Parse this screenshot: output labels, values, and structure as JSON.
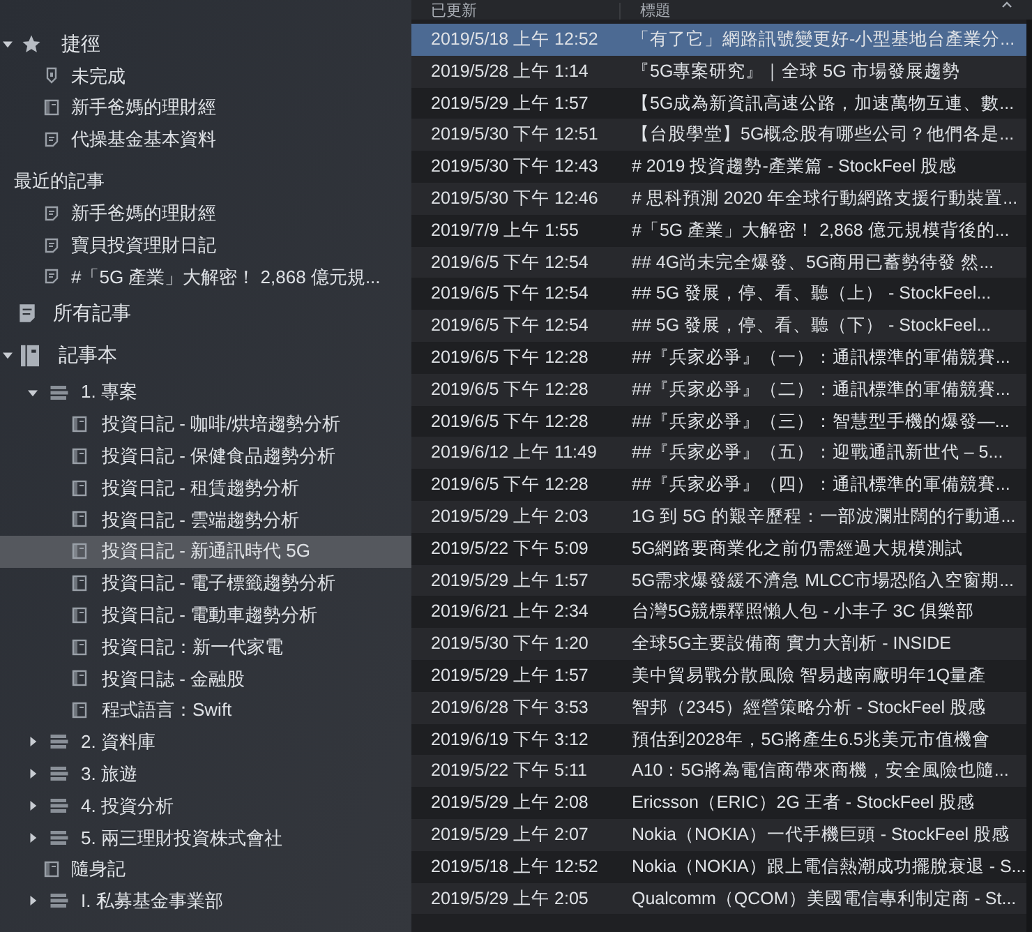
{
  "sidebar": {
    "shortcuts": {
      "label": "捷徑",
      "expanded": true,
      "items": [
        {
          "label": "未完成",
          "kind": "tag"
        },
        {
          "label": "新手爸媽的理財經",
          "kind": "notebook"
        },
        {
          "label": "代操基金基本資料",
          "kind": "note"
        }
      ]
    },
    "recent": {
      "label": "最近的記事",
      "items": [
        {
          "label": "新手爸媽的理財經",
          "kind": "note"
        },
        {
          "label": "寶貝投資理財日記",
          "kind": "note"
        },
        {
          "label": "#「5G 產業」大解密！ 2,868 億元規...",
          "kind": "note"
        }
      ]
    },
    "all_notes": {
      "label": "所有記事"
    },
    "notebooks": {
      "label": "記事本",
      "expanded": true,
      "children": [
        {
          "label": "1. 專案",
          "kind": "stack",
          "expanded": true,
          "children": [
            {
              "label": "投資日記 - 咖啡/烘培趨勢分析",
              "kind": "notebook",
              "selected": false
            },
            {
              "label": "投資日記 - 保健食品趨勢分析",
              "kind": "notebook",
              "selected": false
            },
            {
              "label": "投資日記 - 租賃趨勢分析",
              "kind": "notebook",
              "selected": false
            },
            {
              "label": "投資日記 - 雲端趨勢分析",
              "kind": "notebook",
              "selected": false
            },
            {
              "label": "投資日記 - 新通訊時代 5G",
              "kind": "notebook",
              "selected": true
            },
            {
              "label": "投資日記 - 電子標籤趨勢分析",
              "kind": "notebook",
              "selected": false
            },
            {
              "label": "投資日記 - 電動車趨勢分析",
              "kind": "notebook",
              "selected": false
            },
            {
              "label": "投資日記：新一代家電",
              "kind": "notebook",
              "selected": false
            },
            {
              "label": "投資日誌 -  金融股",
              "kind": "notebook",
              "selected": false
            },
            {
              "label": "程式語言：Swift",
              "kind": "notebook",
              "selected": false
            }
          ]
        },
        {
          "label": "2. 資料庫",
          "kind": "stack",
          "expanded": false
        },
        {
          "label": "3. 旅遊",
          "kind": "stack",
          "expanded": false
        },
        {
          "label": "4. 投資分析",
          "kind": "stack",
          "expanded": false
        },
        {
          "label": "5. 兩三理財投資株式會社",
          "kind": "stack",
          "expanded": false
        },
        {
          "label": "隨身記",
          "kind": "notebook"
        },
        {
          "label": "I. 私募基金事業部",
          "kind": "stack",
          "expanded": false
        }
      ]
    }
  },
  "note_list": {
    "columns": [
      "已更新",
      "標題"
    ],
    "rows": [
      {
        "updated": "2019/5/18 上午 12:52",
        "title": "「有了它」網路訊號變更好-小型基地台產業分...",
        "selected": true
      },
      {
        "updated": "2019/5/28 上午 1:14",
        "title": "『5G專案研究』｜全球 5G 市場發展趨勢",
        "selected": false
      },
      {
        "updated": "2019/5/29 上午 1:57",
        "title": "【5G成為新資訊高速公路，加速萬物互連、數...",
        "selected": false
      },
      {
        "updated": "2019/5/30 下午 12:51",
        "title": "【台股學堂】5G概念股有哪些公司？他們各是...",
        "selected": false
      },
      {
        "updated": "2019/5/30 下午 12:43",
        "title": "# 2019 投資趨勢-產業篇 - StockFeel 股感",
        "selected": false
      },
      {
        "updated": "2019/5/30 下午 12:46",
        "title": "# 思科預測 2020 年全球行動網路支援行動裝置...",
        "selected": false
      },
      {
        "updated": "2019/7/9 上午 1:55",
        "title": "#「5G 產業」大解密！ 2,868 億元規模背後的...",
        "selected": false
      },
      {
        "updated": "2019/6/5 下午 12:54",
        "title": "## 4G尚未完全爆發、5G商用已蓄勢待發 然...",
        "selected": false
      },
      {
        "updated": "2019/6/5 下午 12:54",
        "title": "## 5G 發展，停、看、聽（上） - StockFeel...",
        "selected": false
      },
      {
        "updated": "2019/6/5 下午 12:54",
        "title": "## 5G 發展，停、看、聽（下） - StockFeel...",
        "selected": false
      },
      {
        "updated": "2019/6/5 下午 12:28",
        "title": "##『兵家必爭』（一）：通訊標準的軍備競賽...",
        "selected": false
      },
      {
        "updated": "2019/6/5 下午 12:28",
        "title": "##『兵家必爭』（二）：通訊標準的軍備競賽...",
        "selected": false
      },
      {
        "updated": "2019/6/5 下午 12:28",
        "title": "##『兵家必爭』（三）：智慧型手機的爆發—...",
        "selected": false
      },
      {
        "updated": "2019/6/12 上午 11:49",
        "title": "##『兵家必爭』（五）：迎戰通訊新世代 – 5...",
        "selected": false
      },
      {
        "updated": "2019/6/5 下午 12:28",
        "title": "##『兵家必爭』（四）：通訊標準的軍備競賽...",
        "selected": false
      },
      {
        "updated": "2019/5/29 上午 2:03",
        "title": "1G 到 5G 的艱辛歷程：一部波瀾壯闊的行動通...",
        "selected": false
      },
      {
        "updated": "2019/5/22 下午 5:09",
        "title": "5G網路要商業化之前仍需經過大規模測試",
        "selected": false
      },
      {
        "updated": "2019/5/29 上午 1:57",
        "title": "5G需求爆發緩不濟急 MLCC市場恐陷入空窗期...",
        "selected": false
      },
      {
        "updated": "2019/6/21 上午 2:34",
        "title": "台灣5G競標釋照懶人包 - 小丰子 3C 俱樂部",
        "selected": false
      },
      {
        "updated": "2019/5/30 下午 1:20",
        "title": "全球5G主要設備商 實力大剖析 - INSIDE",
        "selected": false
      },
      {
        "updated": "2019/5/29 上午 1:57",
        "title": "美中貿易戰分散風險 智易越南廠明年1Q量產",
        "selected": false
      },
      {
        "updated": "2019/6/28 下午 3:53",
        "title": "智邦（2345）經營策略分析 - StockFeel 股感",
        "selected": false
      },
      {
        "updated": "2019/6/19 下午 3:12",
        "title": "預估到2028年，5G將產生6.5兆美元市值機會",
        "selected": false
      },
      {
        "updated": "2019/5/22 下午 5:11",
        "title": "A10：5G將為電信商帶來商機，安全風險也隨...",
        "selected": false
      },
      {
        "updated": "2019/5/29 上午 2:08",
        "title": "Ericsson（ERIC）2G 王者 - StockFeel 股感",
        "selected": false
      },
      {
        "updated": "2019/5/29 上午 2:07",
        "title": "Nokia（NOKIA）一代手機巨頭 - StockFeel 股感",
        "selected": false
      },
      {
        "updated": "2019/5/18 上午 12:52",
        "title": "Nokia（NOKIA）跟上電信熱潮成功擺脫衰退 - S...",
        "selected": false
      },
      {
        "updated": "2019/5/29 上午 2:05",
        "title": "Qualcomm（QCOM）美國電信專利制定商 - St...",
        "selected": false
      }
    ]
  }
}
